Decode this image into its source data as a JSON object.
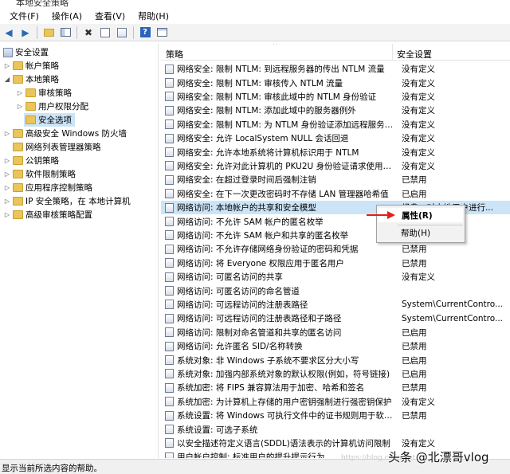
{
  "window": {
    "title": "本地安全策略"
  },
  "menu": [
    "文件(F)",
    "操作(A)",
    "查看(V)",
    "帮助(H)"
  ],
  "toolbar": {
    "icons": [
      "back-icon",
      "forward-icon",
      "up-folder-icon",
      "show-tree-icon",
      "delete-icon",
      "properties-icon",
      "export-icon",
      "help-icon",
      "console-icon"
    ]
  },
  "tree": {
    "root": "安全设置",
    "items": [
      {
        "label": "帐户策略",
        "level": 1,
        "expanded": false
      },
      {
        "label": "本地策略",
        "level": 1,
        "expanded": true
      },
      {
        "label": "审核策略",
        "level": 2,
        "expanded": false
      },
      {
        "label": "用户权限分配",
        "level": 2,
        "expanded": false
      },
      {
        "label": "安全选项",
        "level": 2,
        "selected": true
      },
      {
        "label": "高级安全 Windows 防火墙",
        "level": 1,
        "expanded": false
      },
      {
        "label": "网络列表管理器策略",
        "level": 1
      },
      {
        "label": "公钥策略",
        "level": 1,
        "expanded": false
      },
      {
        "label": "软件限制策略",
        "level": 1,
        "expanded": false
      },
      {
        "label": "应用程序控制策略",
        "level": 1,
        "expanded": false
      },
      {
        "label": "IP 安全策略，在 本地计算机",
        "level": 1,
        "expanded": false
      },
      {
        "label": "高级审核策略配置",
        "level": 1,
        "expanded": false
      }
    ]
  },
  "columns": {
    "policy": "策略",
    "setting": "安全设置"
  },
  "policies": [
    {
      "name": "网络安全: 限制 NTLM: 到远程服务器的传出 NTLM 流量",
      "value": "没有定义"
    },
    {
      "name": "网络安全: 限制 NTLM: 审核传入 NTLM 流量",
      "value": "没有定义"
    },
    {
      "name": "网络安全: 限制 NTLM: 审核此域中的 NTLM 身份验证",
      "value": "没有定义"
    },
    {
      "name": "网络安全: 限制 NTLM: 添加此域中的服务器例外",
      "value": "没有定义"
    },
    {
      "name": "网络安全: 限制 NTLM: 为 NTLM 身份验证添加远程服务器...",
      "value": "没有定义"
    },
    {
      "name": "网络安全: 允许 LocalSystem NULL 会话回退",
      "value": "没有定义"
    },
    {
      "name": "网络安全: 允许本地系统将计算机标识用于 NTLM",
      "value": "没有定义"
    },
    {
      "name": "网络安全: 允许对此计算机的 PKU2U 身份验证请求使用联...",
      "value": "没有定义"
    },
    {
      "name": "网络安全: 在超过登录时间后强制注销",
      "value": "已禁用"
    },
    {
      "name": "网络安全: 在下一次更改密码时不存储 LAN 管理器哈希值",
      "value": "已启用"
    },
    {
      "name": "网络访问: 本地帐户的共享和安全模型",
      "value": "经典 - 对本地用户进行...",
      "highlighted": true
    },
    {
      "name": "网络访问: 不允许 SAM 帐户的匿名枚举",
      "value": ""
    },
    {
      "name": "网络访问: 不允许 SAM 帐户和共享的匿名枚举",
      "value": ""
    },
    {
      "name": "网络访问: 不允许存储网络身份验证的密码和凭据",
      "value": "已禁用"
    },
    {
      "name": "网络访问: 将 Everyone 权限应用于匿名用户",
      "value": "已禁用"
    },
    {
      "name": "网络访问: 可匿名访问的共享",
      "value": "没有定义"
    },
    {
      "name": "网络访问: 可匿名访问的命名管道",
      "value": ""
    },
    {
      "name": "网络访问: 可远程访问的注册表路径",
      "value": "System\\CurrentContro..."
    },
    {
      "name": "网络访问: 可远程访问的注册表路径和子路径",
      "value": "System\\CurrentContro..."
    },
    {
      "name": "网络访问: 限制对命名管道和共享的匿名访问",
      "value": "已启用"
    },
    {
      "name": "网络访问: 允许匿名 SID/名称转换",
      "value": "已禁用"
    },
    {
      "name": "系统对象: 非 Windows 子系统不要求区分大小写",
      "value": "已启用"
    },
    {
      "name": "系统对象: 加强内部系统对象的默认权限(例如，符号链接)",
      "value": "已启用"
    },
    {
      "name": "系统加密: 将 FIPS 兼容算法用于加密、哈希和签名",
      "value": "已禁用"
    },
    {
      "name": "系统加密: 为计算机上存储的用户密钥强制进行强密钥保护",
      "value": "没有定义"
    },
    {
      "name": "系统设置: 将 Windows 可执行文件中的证书规则用于软件...",
      "value": "已禁用"
    },
    {
      "name": "系统设置: 可选子系统",
      "value": ""
    },
    {
      "name": "以安全描述符定义语言(SDDL)语法表示的计算机访问限制",
      "value": "没有定义"
    },
    {
      "name": "用户帐户控制: 标准用户的提升提示行为",
      "value": ""
    }
  ],
  "context_menu": {
    "properties": "属性(R)",
    "help": "帮助(H)"
  },
  "status": "显示当前所选内容的帮助。",
  "watermark": "头条 @北漂哥vlog",
  "watermark_url": "https://blog.csdn.net"
}
